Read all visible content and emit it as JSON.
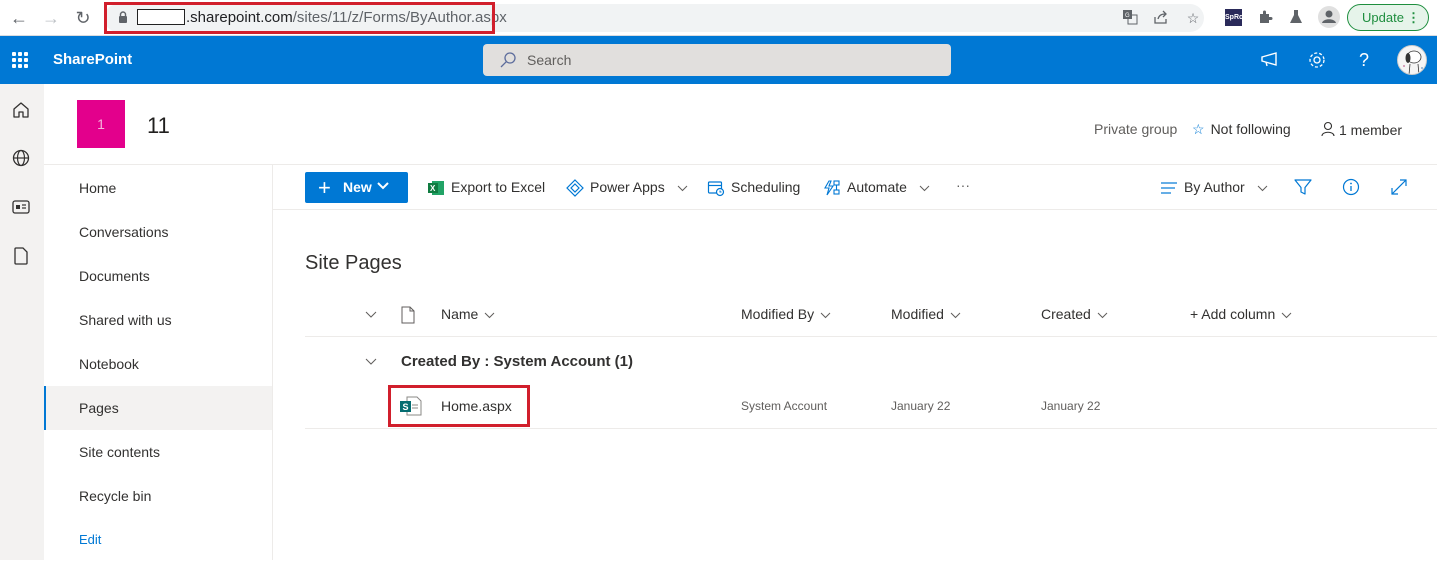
{
  "browser": {
    "url_domain": ".sharepoint.com",
    "url_path": "/sites/11/z/Forms/ByAuthor.aspx",
    "update_label": "Update",
    "extension_label": "SpRc"
  },
  "suitebar": {
    "brand": "SharePoint",
    "search_placeholder": "Search"
  },
  "site": {
    "logo_text": "1",
    "title": "11",
    "privacy": "Private group",
    "follow_label": "Not following",
    "members_label": "1 member"
  },
  "leftnav": {
    "items": [
      {
        "label": "Home"
      },
      {
        "label": "Conversations"
      },
      {
        "label": "Documents"
      },
      {
        "label": "Shared with us"
      },
      {
        "label": "Notebook"
      },
      {
        "label": "Pages",
        "selected": true
      },
      {
        "label": "Site contents"
      },
      {
        "label": "Recycle bin"
      }
    ],
    "edit_label": "Edit"
  },
  "commandbar": {
    "new_label": "New",
    "export_label": "Export to Excel",
    "powerapps_label": "Power Apps",
    "scheduling_label": "Scheduling",
    "automate_label": "Automate",
    "more_label": "···",
    "view_label": "By Author"
  },
  "list": {
    "title": "Site Pages",
    "columns": {
      "name": "Name",
      "modified_by": "Modified By",
      "modified": "Modified",
      "created": "Created",
      "add_column": "+ Add column"
    },
    "group": {
      "label": "Created By : System Account (1)"
    },
    "rows": [
      {
        "name": "Home.aspx",
        "modified_by": "System Account",
        "modified": "January 22",
        "created": "January 22"
      }
    ]
  },
  "colors": {
    "brand_blue": "#0078d4",
    "site_logo": "#e3008c",
    "highlight_red": "#d11f2c"
  }
}
